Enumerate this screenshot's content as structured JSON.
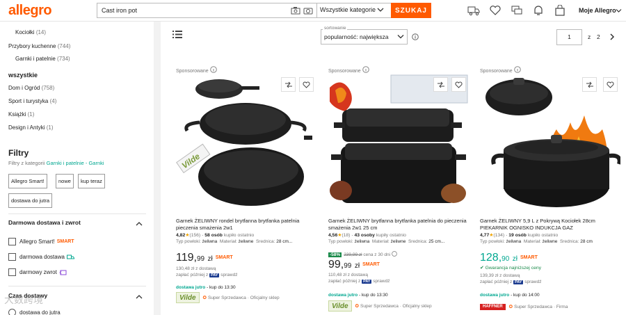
{
  "header": {
    "logo": "allegro",
    "search_value": "Cast iron pot",
    "category": "Wszystkie kategorie",
    "search_button": "SZUKAJ",
    "account": "Moje Allegro"
  },
  "sidebar": {
    "categories": [
      {
        "label": "Kociołki",
        "count": "(14)"
      },
      {
        "label": "Przybory kuchenne",
        "count": "(744)"
      },
      {
        "label": "Garnki i patelnie",
        "count": "(734)"
      }
    ],
    "all_heading": "wszystkie",
    "all_items": [
      {
        "label": "Dom i Ogród",
        "count": "(758)"
      },
      {
        "label": "Sport i turystyka",
        "count": "(4)"
      },
      {
        "label": "Książki",
        "count": "(1)"
      },
      {
        "label": "Design i Antyki",
        "count": "(1)"
      }
    ],
    "filters_title": "Filtry",
    "filters_sub_prefix": "Filtry z kategorii",
    "filters_sub_link": "Garnki i patelnie - Garnki",
    "chips": [
      "Allegro Smart!",
      "nowe",
      "kup teraz",
      "dostawa do jutra"
    ],
    "free_delivery_title": "Darmowa dostawa i zwrot",
    "free_delivery_options": [
      {
        "label": "Allegro Smart!",
        "badge": "SMART"
      },
      {
        "label": "darmowa dostawa",
        "badge": ""
      },
      {
        "label": "darmowy zwrot",
        "badge": ""
      }
    ],
    "delivery_time_title": "Czas dostawy",
    "delivery_time_first": "dostawa do jutra"
  },
  "toolbar": {
    "sort_label": "sortowanie",
    "sort_value": "popularność: największa",
    "current_page": "1",
    "page_of": "z",
    "total_pages": "2"
  },
  "products": [
    {
      "sponsored": "Sponsorowane",
      "title": "Garnek ŻELIWNY rondel brytfanna brytfanka patelnia pieczenia smażenia 2w1",
      "rating": "4,82",
      "reviews": "(156)",
      "buyers": "58 osób",
      "buyers_suffix": "kupiło ostatnio",
      "param_type_label": "Typ powłoki:",
      "param_type": "żeliwna",
      "param_mat_label": "Materiał:",
      "param_mat": "żeliwne",
      "param_dia_label": "Średnica:",
      "param_dia": "28 cm...",
      "price_main": "119,",
      "price_cents": "99",
      "currency": "zł",
      "smart": "SMART",
      "with_delivery": "130,48 zł z dostawą",
      "pay_later": "zapłać później z",
      "pay_brand": "PAY",
      "pay_check": "sprawdź",
      "delivery_bold": "dostawa jutro",
      "delivery_rest": "- kup do 13:30",
      "brand": "Vilde",
      "seller_type": "Super Sprzedawca",
      "shop_type": "Oficjalny sklep"
    },
    {
      "sponsored": "Sponsorowane",
      "title": "Garnek ŻELIWNY brytfanna brytfanka patelnia do pieczenia smażenia 2w1 25 cm",
      "rating": "4,56",
      "reviews": "(18)",
      "buyers": "43 osoby",
      "buyers_suffix": "kupiły ostatnio",
      "param_type_label": "Typ powłoki:",
      "param_type": "żeliwna",
      "param_mat_label": "Materiał:",
      "param_mat": "żeliwne",
      "param_dia_label": "Średnica:",
      "param_dia": "25 cm...",
      "discount": "-58%",
      "old_price": "239,99 zł",
      "discount_note": "cena z 30 dni",
      "price_main": "99,",
      "price_cents": "99",
      "currency": "zł",
      "smart": "SMART",
      "with_delivery": "110,48 zł z dostawą",
      "pay_later": "zapłać później z",
      "pay_brand": "PAY",
      "pay_check": "sprawdź",
      "delivery_bold": "dostawa jutro",
      "delivery_rest": "- kup do 13:30",
      "brand": "Vilde",
      "seller_type": "Super Sprzedawca",
      "shop_type": "Oficjalny sklep"
    },
    {
      "sponsored": "Sponsorowane",
      "title": "Garnek ŻELIWNY 5,9 L z Pokrywą Kociołek 28cm PIEKARNIK OGNISKO INDUKCJA GAZ",
      "rating": "4,77",
      "reviews": "(134)",
      "buyers": "19 osób",
      "buyers_suffix": "kupiło ostatnio",
      "param_type_label": "Typ powłoki:",
      "param_type": "żeliwna",
      "param_mat_label": "Materiał:",
      "param_mat": "żeliwne",
      "param_dia_label": "Średnica:",
      "param_dia": "28 cm",
      "price_main": "128,",
      "price_cents": "90",
      "currency": "zł",
      "smart": "SMART",
      "guarantee": "Gwarancja najniższej ceny",
      "with_delivery": "139,39 zł z dostawą",
      "pay_later": "zapłać później z",
      "pay_brand": "PAY",
      "pay_check": "sprawdź",
      "delivery_bold": "dostawa jutro",
      "delivery_rest": "- kup do 14:00",
      "brand": "HAFFNER",
      "seller_type": "Super Sprzedawca",
      "shop_type": "Firma"
    }
  ],
  "watermark": "大数跨境",
  "colors": {
    "accent": "#ff5a00",
    "teal": "#00a790",
    "green": "#1a8a4a"
  }
}
